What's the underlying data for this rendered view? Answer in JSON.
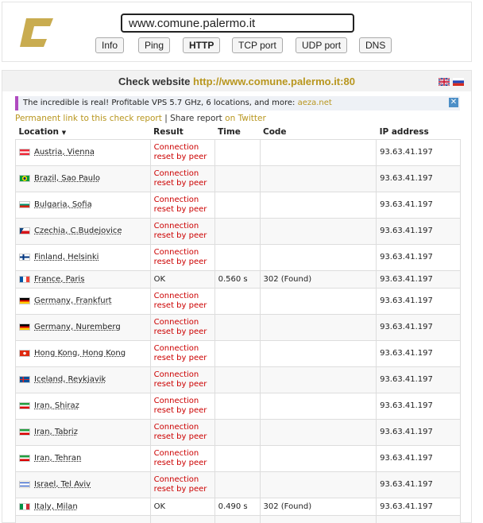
{
  "search": {
    "value": "www.comune.palermo.it"
  },
  "buttons": [
    {
      "label": "Info",
      "active": false
    },
    {
      "label": "Ping",
      "active": false
    },
    {
      "label": "HTTP",
      "active": true
    },
    {
      "label": "TCP port",
      "active": false
    },
    {
      "label": "UDP port",
      "active": false
    },
    {
      "label": "DNS",
      "active": false
    }
  ],
  "check": {
    "prefix": "Check website",
    "url": "http://www.comune.palermo.it:80"
  },
  "ad": {
    "text": "The incredible is real! Profitable VPS 5.7 GHz, 6 locations, and more: ",
    "link": "aeza.net",
    "close": "✕"
  },
  "links": {
    "permanent": "Permanent link to this check report",
    "sep": " | ",
    "share": "Share report",
    "on": " on ",
    "twitter": "Twitter"
  },
  "table": {
    "headers": {
      "location": "Location",
      "sort": "▼",
      "result": "Result",
      "time": "Time",
      "code": "Code",
      "ip": "IP address"
    },
    "rows": [
      {
        "location": "Austria, Vienna",
        "result": "Connection reset by peer",
        "time": "",
        "code": "",
        "ip": "93.63.41.197"
      },
      {
        "location": "Brazil, Sao Paulo",
        "result": "Connection reset by peer",
        "time": "",
        "code": "",
        "ip": "93.63.41.197"
      },
      {
        "location": "Bulgaria, Sofia",
        "result": "Connection reset by peer",
        "time": "",
        "code": "",
        "ip": "93.63.41.197"
      },
      {
        "location": "Czechia, C.Budejovice",
        "result": "Connection reset by peer",
        "time": "",
        "code": "",
        "ip": "93.63.41.197"
      },
      {
        "location": "Finland, Helsinki",
        "result": "Connection reset by peer",
        "time": "",
        "code": "",
        "ip": "93.63.41.197"
      },
      {
        "location": "France, Paris",
        "result": "OK",
        "time": "0.560 s",
        "code": "302 (Found)",
        "ip": "93.63.41.197"
      },
      {
        "location": "Germany, Frankfurt",
        "result": "Connection reset by peer",
        "time": "",
        "code": "",
        "ip": "93.63.41.197"
      },
      {
        "location": "Germany, Nuremberg",
        "result": "Connection reset by peer",
        "time": "",
        "code": "",
        "ip": "93.63.41.197"
      },
      {
        "location": "Hong Kong, Hong Kong",
        "result": "Connection reset by peer",
        "time": "",
        "code": "",
        "ip": "93.63.41.197"
      },
      {
        "location": "Iceland, Reykjavik",
        "result": "Connection reset by peer",
        "time": "",
        "code": "",
        "ip": "93.63.41.197"
      },
      {
        "location": "Iran, Shiraz",
        "result": "Connection reset by peer",
        "time": "",
        "code": "",
        "ip": "93.63.41.197"
      },
      {
        "location": "Iran, Tabriz",
        "result": "Connection reset by peer",
        "time": "",
        "code": "",
        "ip": "93.63.41.197"
      },
      {
        "location": "Iran, Tehran",
        "result": "Connection reset by peer",
        "time": "",
        "code": "",
        "ip": "93.63.41.197"
      },
      {
        "location": "Israel, Tel Aviv",
        "result": "Connection reset by peer",
        "time": "",
        "code": "",
        "ip": "93.63.41.197"
      },
      {
        "location": "Italy, Milan",
        "result": "OK",
        "time": "0.490 s",
        "code": "302 (Found)",
        "ip": "93.63.41.197"
      },
      {
        "location": "",
        "result": "Connection",
        "time": "",
        "code": "",
        "ip": ""
      }
    ]
  },
  "colors": {
    "gold": "#b8961e",
    "error": "#cc0000",
    "adBar": "#b04ac0"
  }
}
